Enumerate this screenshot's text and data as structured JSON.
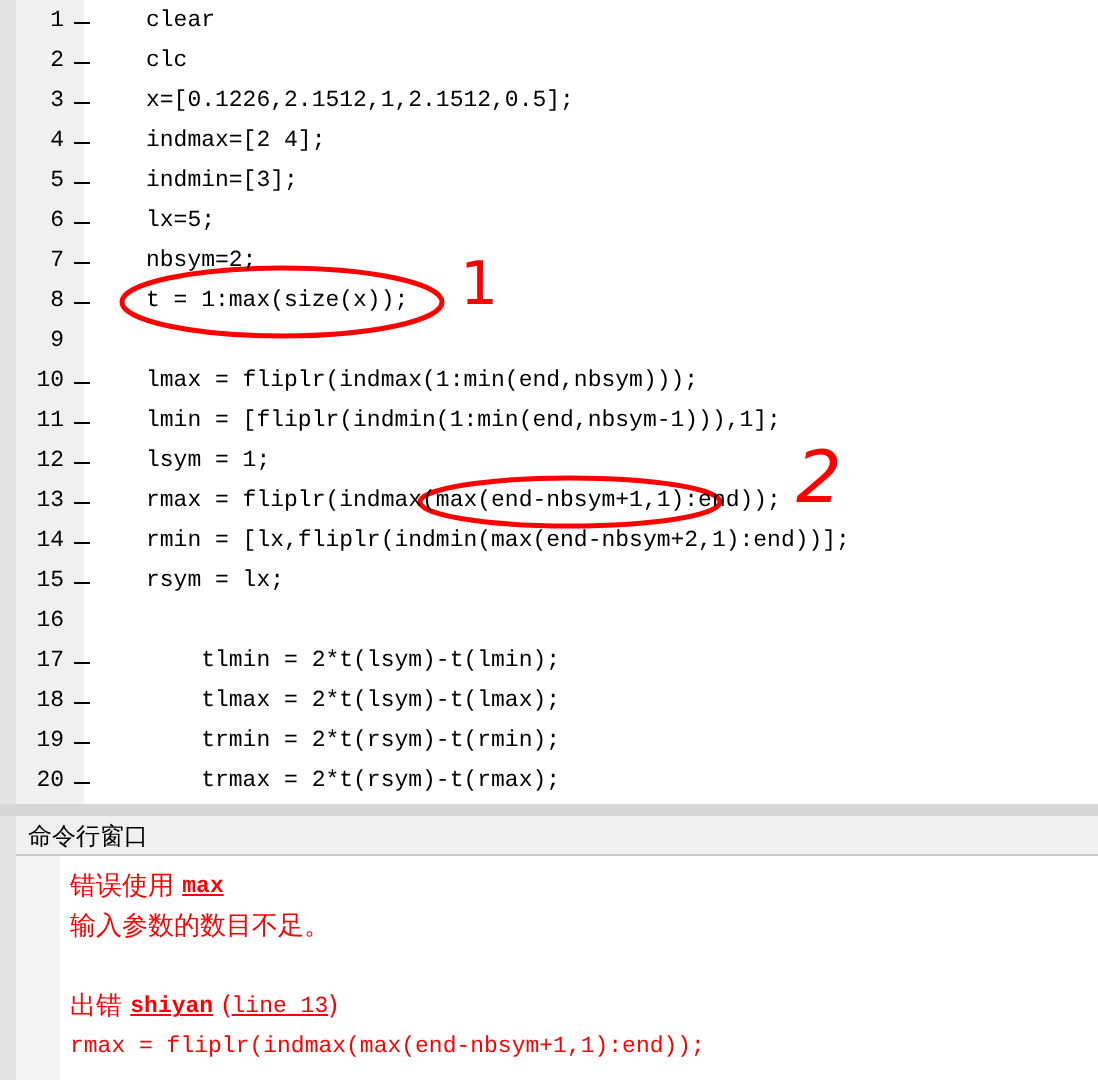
{
  "editor": {
    "lines": [
      {
        "number": "1",
        "executable": true,
        "text": "clear"
      },
      {
        "number": "2",
        "executable": true,
        "text": "clc"
      },
      {
        "number": "3",
        "executable": true,
        "text": "x=[0.1226,2.1512,1,2.1512,0.5];"
      },
      {
        "number": "4",
        "executable": true,
        "text": "indmax=[2 4];"
      },
      {
        "number": "5",
        "executable": true,
        "text": "indmin=[3];"
      },
      {
        "number": "6",
        "executable": true,
        "text": "lx=5;"
      },
      {
        "number": "7",
        "executable": true,
        "text": "nbsym=2;"
      },
      {
        "number": "8",
        "executable": true,
        "text": "t = 1:max(size(x));"
      },
      {
        "number": "9",
        "executable": false
      },
      {
        "number": "10",
        "executable": true,
        "text": "lmax = fliplr(indmax(1:min(end,nbsym)));"
      },
      {
        "number": "11",
        "executable": true,
        "text": "lmin = [fliplr(indmin(1:min(end,nbsym-1))),1];"
      },
      {
        "number": "12",
        "executable": true,
        "text": "lsym = 1;"
      },
      {
        "number": "13",
        "executable": true,
        "text": "rmax = fliplr(indmax(max(end-nbsym+1,1):end));"
      },
      {
        "number": "14",
        "executable": true,
        "text": "rmin = [lx,fliplr(indmin(max(end-nbsym+2,1):end))];"
      },
      {
        "number": "15",
        "executable": true,
        "text": "rsym = lx;"
      },
      {
        "number": "16",
        "executable": false
      },
      {
        "number": "17",
        "executable": true,
        "text": "    tlmin = 2*t(lsym)-t(lmin);"
      },
      {
        "number": "18",
        "executable": true,
        "text": "    tlmax = 2*t(lsym)-t(lmax);"
      },
      {
        "number": "19",
        "executable": true,
        "text": "    trmin = 2*t(rsym)-t(rmin);"
      },
      {
        "number": "20",
        "executable": true,
        "text": "    trmax = 2*t(rsym)-t(rmax);"
      }
    ]
  },
  "annotations": [
    {
      "label": "1"
    },
    {
      "label": "2"
    }
  ],
  "command_window": {
    "title": "命令行窗口",
    "lines": [
      {
        "segments": [
          {
            "kind": "text",
            "text": "错误使用 "
          },
          {
            "kind": "link",
            "bold": true,
            "text": "max"
          }
        ]
      },
      {
        "segments": [
          {
            "kind": "text",
            "text": "输入参数的数目不足。"
          }
        ]
      },
      {
        "gap_before": true,
        "segments": [
          {
            "kind": "text",
            "text": "出错 "
          },
          {
            "kind": "link",
            "bold": true,
            "text": "shiyan"
          },
          {
            "kind": "text",
            "text": " ("
          },
          {
            "kind": "link",
            "bold": false,
            "text": "line 13"
          },
          {
            "kind": "text",
            "text": ")"
          }
        ]
      },
      {
        "segments": [
          {
            "kind": "code",
            "text": "rmax = fliplr(indmax(max(end-nbsym+1,1):end));"
          }
        ]
      }
    ]
  }
}
